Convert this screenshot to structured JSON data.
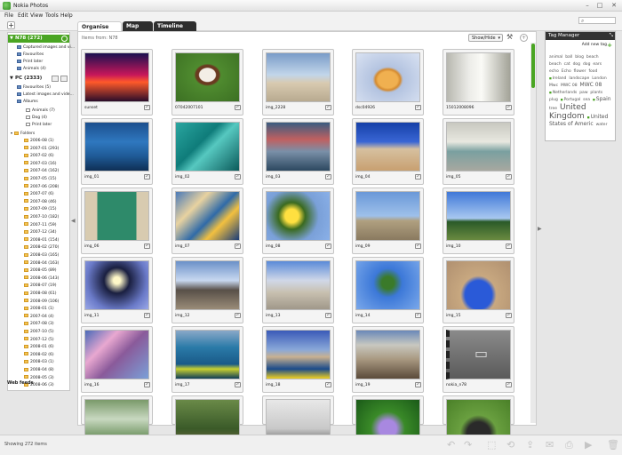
{
  "window": {
    "title": "Nokia Photos"
  },
  "menu": [
    "File",
    "Edit",
    "View",
    "Tools",
    "Help"
  ],
  "tabs": [
    "Organise",
    "Map",
    "Timeline"
  ],
  "main": {
    "items_from": "Items from: N78",
    "show_hide": "Show/Hide"
  },
  "sidebar": {
    "n78": {
      "title": "N78 (272)",
      "items": [
        "Captured images and vi...",
        "Favourites",
        "Print later",
        "Animals (4)"
      ]
    },
    "pc": {
      "title": "PC (2333)",
      "items": [
        "Favourites (5)",
        "Latest images and vide...",
        "Albums"
      ]
    },
    "albums": [
      "Animals (7)",
      "Dog (4)",
      "Print later"
    ],
    "folders_label": "Folders",
    "folders": [
      "2006-08 (1)",
      "2007-01 (293)",
      "2007-02 (6)",
      "2007-03 (16)",
      "2007-04 (162)",
      "2007-05 (15)",
      "2007-06 (208)",
      "2007-07 (6)",
      "2007-08 (46)",
      "2007-09 (15)",
      "2007-10 (182)",
      "2007-11 (59)",
      "2007-12 (34)",
      "2008-01 (154)",
      "2008-02 (270)",
      "2008-03 (165)",
      "2008-04 (163)",
      "2008-05 (89)",
      "2008-06 (143)",
      "2008-07 (19)",
      "2008-08 (61)",
      "2008-09 (106)",
      "2008-01 (1)",
      "2007-04 (4)",
      "2007-08 (3)",
      "2007-10 (5)",
      "2007-12 (5)",
      "2008-01 (6)",
      "2008-02 (6)",
      "2008-03 (1)",
      "2008-04 (8)",
      "2008-05 (3)",
      "2008-06 (3)"
    ],
    "web_feeds": "Web feeds"
  },
  "thumbnails": [
    {
      "label": "sunset",
      "grad": "linear-gradient(#1a1050 0%,#c8175a 45%,#ff5a2a 60%,#2a0c2a 100%)"
    },
    {
      "label": "07042007101",
      "grad": "radial-gradient(ellipse at 50% 45%,#f3eee6 0 18%,#6a3a20 20% 26%,#4f8b2f 30%,#3c7023 100%)"
    },
    {
      "label": "img_2228",
      "grad": "linear-gradient(#7a9cc8 0%,#c2d6ea 45%,#d8cab0 62%,#b8aa90 100%)"
    },
    {
      "label": "dsc04926",
      "grad": "radial-gradient(ellipse at 50% 55%,#f0b050 0 22%,#d48a30 28%,#b3c3e0 34%,#d9e2f2 100%)"
    },
    {
      "label": "15012008096",
      "grad": "linear-gradient(90deg,#b8b8b0 0%,#ecece8 35%,#fafaf6 55%,#a3a398 100%)"
    },
    {
      "label": "img_01",
      "grad": "linear-gradient(#1c4f8e 0%,#2f78bf 40%,#1f5a96 70%,#0f2f55 100%)"
    },
    {
      "label": "img_02",
      "grad": "linear-gradient(135deg,#2aa6a0 0%,#0f7c7a 40%,#56c8c0 55%,#0b5a5a 100%)"
    },
    {
      "label": "img_03",
      "grad": "linear-gradient(#3a5c80 0%,#c06060 35%,#7a90a8 60%,#2c4860 100%)"
    },
    {
      "label": "img_04",
      "grad": "linear-gradient(#1540a8 0%,#3a66d4 40%,#d6c0a0 55%,#c8a070 100%)"
    },
    {
      "label": "img_05",
      "grad": "linear-gradient(#c8c8c0 0%,#e8e8e0 40%,#7aa0a0 60%,#a8a8a0 100%)"
    },
    {
      "label": "img_06",
      "grad": "linear-gradient(90deg,#d8cbb0 0 18%,#2e8a6a 20% 80%,#d8cbb0 82%)"
    },
    {
      "label": "img_07",
      "grad": "linear-gradient(135deg,#4a7ab8 0%,#e8d2a0 30%,#2f6aa8 55%,#f2c040 70%,#1a3c78 100%)"
    },
    {
      "label": "img_08",
      "grad": "radial-gradient(circle at 40% 50%,#ffe040 0 15%,#3a6a20 30%,#7aa0d8 60%,#8ab0e8 100%)"
    },
    {
      "label": "img_09",
      "grad": "linear-gradient(#6a98d8 0%,#9ec0ea 50%,#b0a080 60%,#8a7a60 100%)"
    },
    {
      "label": "img_10",
      "grad": "linear-gradient(#4078d8 0%,#a8c8f0 55%,#2a5a28 62%,#6a8a40 100%)"
    },
    {
      "label": "img_11",
      "grad": "radial-gradient(circle at 50% 40%,#fff8c8 0 8%,#1a1f40 30%,#6a7ac8 70%,#9aa8e8 100%)"
    },
    {
      "label": "img_12",
      "grad": "linear-gradient(#6a90c8 0%,#c8d8f0 40%,#585048 60%,#9a8c78 100%)"
    },
    {
      "label": "img_13",
      "grad": "linear-gradient(#5a8ad8 0%,#d0d8e8 40%,#c8c0b0 65%,#a0988a 100%)"
    },
    {
      "label": "img_14",
      "grad": "radial-gradient(circle at 50% 45%,#3a7a2a 0 15%,#3c78d8 35%,#7aa8ea 100%)"
    },
    {
      "label": "img_15",
      "grad": "radial-gradient(ellipse at 50% 70%,#2a5ad8 0 30%,#c8a880 40%,#b09070 100%)"
    },
    {
      "label": "img_16",
      "grad": "linear-gradient(135deg,#4a6ab8 0%,#e8a8d0 30%,#8a5a9a 55%,#7aa0d8 100%)"
    },
    {
      "label": "img_17",
      "grad": "linear-gradient(#8aa8c8 0%,#2a7aa8 35%,#1a5a88 70%,#c8d030 80%,#0e3c58 100%)"
    },
    {
      "label": "img_18",
      "grad": "linear-gradient(#3a5ab8 0%,#8aa8d8 40%,#c8b090 55%,#1a4a8a 80%,#f0d020 100%)"
    },
    {
      "label": "img_19",
      "grad": "linear-gradient(#6a88b8 0%,#c8c8c0 30%,#a89880 60%,#5a4a3a 100%)"
    },
    {
      "label": "nokia_n78",
      "video": true
    },
    {
      "label": "",
      "grad": "linear-gradient(#7a9a6a 0%,#c8d8c0 40%,#3a6a28 100%)"
    },
    {
      "label": "",
      "grad": "linear-gradient(#6a8a48 0%,#3a5a28 60%,#7a6a48 100%)"
    },
    {
      "label": "",
      "grad": "linear-gradient(#e8e8e8 0%,#c8c8c8 60%,#444 100%)"
    },
    {
      "label": "",
      "grad": "radial-gradient(circle at 50% 60%,#a888e0 0 20%,#3a8a28 40%,#1a5a18 100%)"
    },
    {
      "label": "",
      "grad": "radial-gradient(circle at 50% 70%,#2a2a2a 0 25%,#6aa040 40%,#4a8028 100%)"
    }
  ],
  "tag_manager": {
    "title": "Tag Manager",
    "new_tag": "Add new tag",
    "tags": [
      {
        "t": "animal",
        "s": "s"
      },
      {
        "t": "ball",
        "s": "s"
      },
      {
        "t": "blog",
        "s": "s"
      },
      {
        "t": "beach",
        "s": "s"
      },
      {
        "t": "beach",
        "s": "s"
      },
      {
        "t": "cat",
        "s": "s"
      },
      {
        "t": "dog",
        "s": "s"
      },
      {
        "t": "dog",
        "s": "s"
      },
      {
        "t": "ears",
        "s": "s"
      },
      {
        "t": "echo",
        "s": "s"
      },
      {
        "t": "Echo",
        "s": "s"
      },
      {
        "t": "flower",
        "s": "s"
      },
      {
        "t": "food",
        "s": "s"
      },
      {
        "t": "Ireland",
        "s": "s",
        "d": 1
      },
      {
        "t": "landscape",
        "s": "s"
      },
      {
        "t": "London",
        "s": "s"
      },
      {
        "t": "Mwc",
        "s": "s"
      },
      {
        "t": "MWC 08",
        "s": "s"
      },
      {
        "t": "MWC 08",
        "s": "m"
      },
      {
        "t": "Netherlands",
        "s": "s",
        "d": 1
      },
      {
        "t": "paw",
        "s": "s"
      },
      {
        "t": "plants",
        "s": "s"
      },
      {
        "t": "plug",
        "s": "s"
      },
      {
        "t": "Portugal",
        "s": "s",
        "d": 1
      },
      {
        "t": "sea",
        "s": "s"
      },
      {
        "t": "Spain",
        "s": "m",
        "d": 1
      },
      {
        "t": "tree",
        "s": "s"
      },
      {
        "t": "United Kingdom",
        "s": "b"
      },
      {
        "t": "United States of Americ",
        "s": "m",
        "d": 1
      },
      {
        "t": "water",
        "s": "s"
      }
    ]
  },
  "status": {
    "text": "Showing 272 items"
  },
  "actions": [
    "undo",
    "redo",
    "crop",
    "rotate",
    "share",
    "mail",
    "print",
    "slideshow",
    "delete"
  ]
}
